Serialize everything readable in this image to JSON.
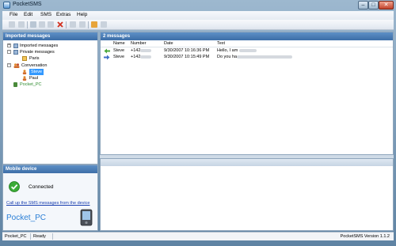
{
  "window": {
    "title": "PocketSMS"
  },
  "menu": [
    "File",
    "Edit",
    "SMS",
    "Extras",
    "Help"
  ],
  "toolbar": {
    "icons": [
      "new-icon",
      "reply-icon",
      "forward-icon",
      "copy-icon",
      "paste-icon",
      "delete-icon",
      "save-icon",
      "print-icon",
      "export-icon",
      "settings-icon"
    ]
  },
  "left_pane": {
    "header": "Imported messages",
    "tree": [
      {
        "label": "Imported messages",
        "level": 0,
        "expander": "+",
        "icon": "messages-folder-icon"
      },
      {
        "label": "Private messages",
        "level": 0,
        "expander": "-",
        "icon": "messages-folder-icon"
      },
      {
        "label": "Paris",
        "level": 1,
        "expander": "",
        "icon": "folder-icon"
      },
      {
        "label": "Conversation",
        "level": 0,
        "expander": "-",
        "icon": "people-icon"
      },
      {
        "label": "Steve",
        "level": 1,
        "expander": "",
        "icon": "person-icon",
        "selected": true
      },
      {
        "label": "Paul",
        "level": 1,
        "expander": "",
        "icon": "person-icon"
      },
      {
        "label": "Pocket_PC",
        "level": 0,
        "expander": "",
        "icon": "device-icon",
        "green": true
      }
    ]
  },
  "right_pane": {
    "header": "2 messages",
    "columns": [
      "Name",
      "Number",
      "Date",
      "Text"
    ],
    "rows": [
      {
        "direction": "incoming-arrow-icon",
        "name": "Steve",
        "number": "+142",
        "date": "9/30/2007 10:16:36 PM",
        "text": "Hello, I am"
      },
      {
        "direction": "outgoing-arrow-icon",
        "name": "Steve",
        "number": "+142",
        "date": "9/30/2007 10:15:49 PM",
        "text": "Do you ha"
      }
    ]
  },
  "device_panel": {
    "header": "Mobile device",
    "status": "Connected",
    "link": "Call up the SMS messages from the device",
    "device_name": "Pocket_PC"
  },
  "statusbar": {
    "device": "Pocket_PC",
    "state": "Ready",
    "version": "PocketSMS Version 1.1.2"
  },
  "colors": {
    "header": "#3d6ea7",
    "device_name": "#2b7fd6",
    "link": "#1a3fb0"
  }
}
